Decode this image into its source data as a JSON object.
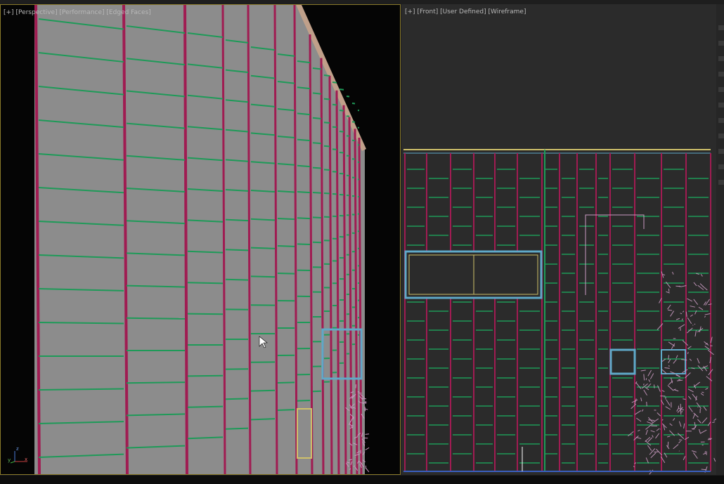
{
  "left_viewport": {
    "labels": [
      "[+]",
      "[Perspective]",
      "[Performance]",
      "[Edged Faces]"
    ],
    "axis": {
      "x": "x",
      "y": "y",
      "z": "z"
    }
  },
  "right_viewport": {
    "labels": [
      "[+]",
      "[Front]",
      "[User Defined]",
      "[Wireframe]"
    ]
  },
  "colors": {
    "facade_gray": "#8c8c8c",
    "mullion_magenta": "#a01c52",
    "edge_green": "#1e9a58",
    "window_cyan": "#5fa9c8",
    "tree_pink": "#c99ac0",
    "border_yellow": "#8a7a2a"
  }
}
